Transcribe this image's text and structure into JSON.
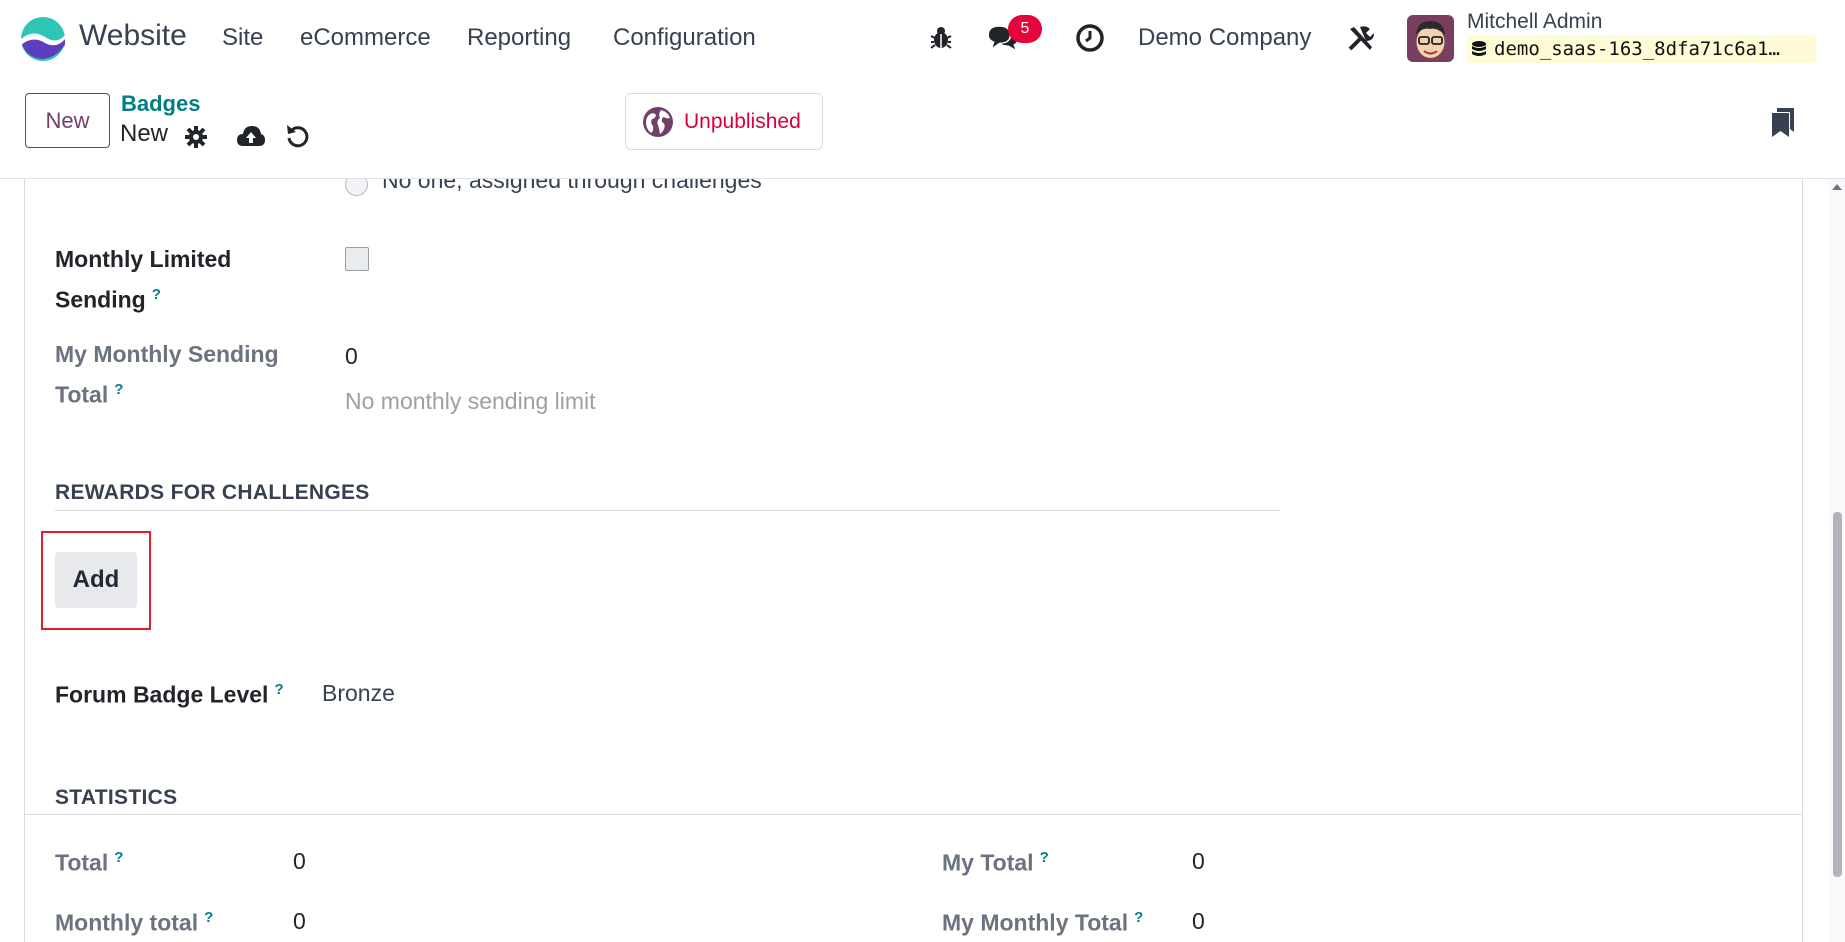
{
  "navbar": {
    "app_name": "Website",
    "menu": [
      "Site",
      "eCommerce",
      "Reporting",
      "Configuration"
    ],
    "messages_count": "5",
    "company": "Demo Company",
    "user_name": "Mitchell Admin",
    "database": "demo_saas-163_8dfa71c6a1…"
  },
  "control_panel": {
    "new_button": "New",
    "breadcrumb_parent": "Badges",
    "breadcrumb_current": "New",
    "publish_status": "Unpublished"
  },
  "form": {
    "radio_option_label": "No one, assigned through challenges",
    "monthly_limited_label_1": "Monthly Limited",
    "monthly_limited_label_2": "Sending",
    "monthly_limited_checked": false,
    "my_monthly_sending_label_1": "My Monthly Sending",
    "my_monthly_sending_label_2": "Total",
    "my_monthly_sending_value": "0",
    "no_limit_text": "No monthly sending limit",
    "rewards_section": "REWARDS FOR CHALLENGES",
    "add_button": "Add",
    "forum_badge_level_label": "Forum Badge Level",
    "forum_badge_level_value": "Bronze",
    "statistics_section": "STATISTICS",
    "question_mark": "?",
    "stats": {
      "total_label": "Total",
      "total_value": "0",
      "monthly_total_label": "Monthly total",
      "monthly_total_value": "0",
      "my_total_label": "My Total",
      "my_total_value": "0",
      "my_monthly_total_label": "My Monthly Total",
      "my_monthly_total_value": "0"
    }
  },
  "colors": {
    "brand_purple": "#71406a",
    "link_teal": "#017e84",
    "unpublished_red": "#d9003b",
    "badge_red": "#e3053b",
    "highlight_red": "#e11d2a"
  },
  "icons": [
    "app-logo-icon",
    "bug-icon",
    "chat-icon",
    "clock-icon",
    "tools-icon",
    "database-icon",
    "gear-icon",
    "cloud-upload-icon",
    "undo-icon",
    "globe-icon",
    "bookmark-icon"
  ]
}
